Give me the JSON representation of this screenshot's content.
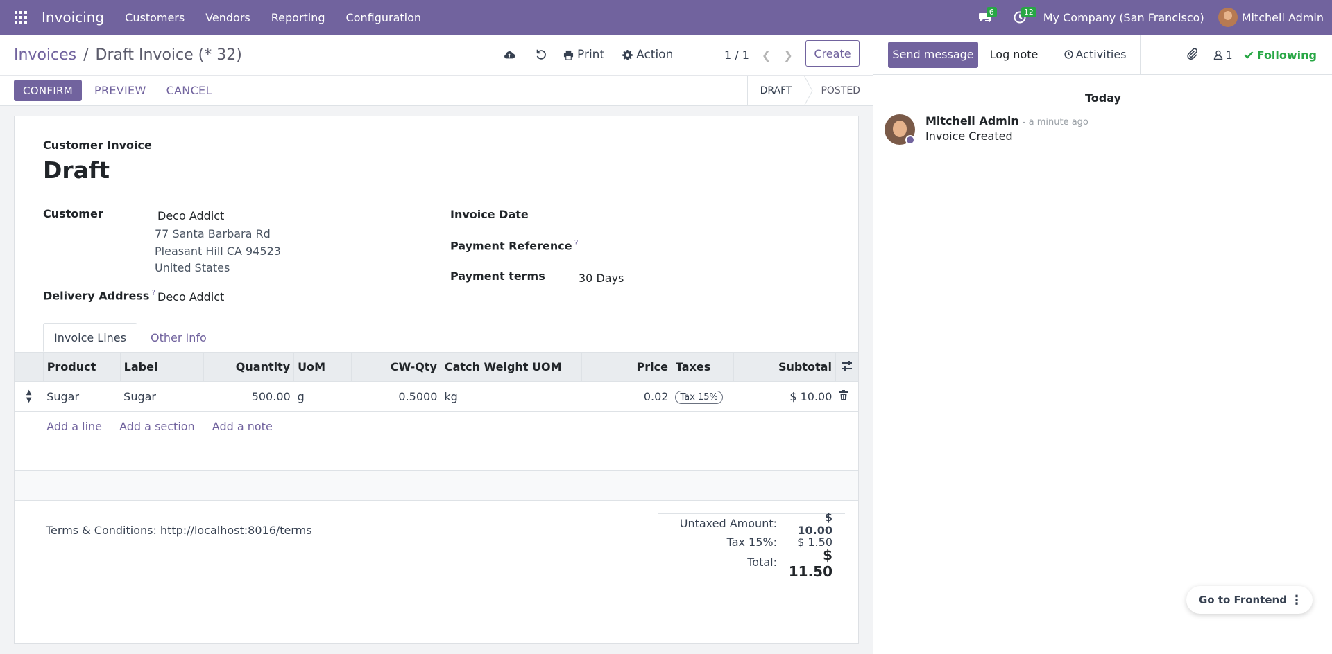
{
  "navbar": {
    "app_name": "Invoicing",
    "menus": [
      "Customers",
      "Vendors",
      "Reporting",
      "Configuration"
    ],
    "messages_count": "6",
    "activities_count": "12",
    "company": "My Company (San Francisco)",
    "user": "Mitchell Admin"
  },
  "breadcrumb": {
    "parent": "Invoices",
    "separator": "/",
    "current": "Draft Invoice (* 32)"
  },
  "toolbar": {
    "print_label": "Print",
    "action_label": "Action",
    "pager": "1 / 1",
    "create_label": "Create"
  },
  "buttons": {
    "confirm": "CONFIRM",
    "preview": "PREVIEW",
    "cancel": "CANCEL"
  },
  "status": {
    "draft": "DRAFT",
    "posted": "POSTED",
    "active": "DRAFT"
  },
  "form": {
    "doc_type": "Customer Invoice",
    "title": "Draft",
    "customer_label": "Customer",
    "customer_name": "Deco Addict",
    "address_line1": "77 Santa Barbara Rd",
    "address_line2": "Pleasant Hill CA 94523",
    "address_line3": "United States",
    "delivery_label": "Delivery Address",
    "delivery_value": "Deco Addict",
    "invoice_date_label": "Invoice Date",
    "payment_ref_label": "Payment Reference",
    "payment_terms_label": "Payment terms",
    "payment_terms_value": "30 Days",
    "help_mark": "?"
  },
  "tabs": {
    "lines": "Invoice Lines",
    "other": "Other Info"
  },
  "table": {
    "headers": {
      "product": "Product",
      "label": "Label",
      "quantity": "Quantity",
      "uom": "UoM",
      "cwqty": "CW-Qty",
      "cwuom": "Catch Weight UOM",
      "price": "Price",
      "taxes": "Taxes",
      "subtotal": "Subtotal"
    },
    "row": {
      "product": "Sugar",
      "label": "Sugar",
      "quantity": "500.00",
      "uom": "g",
      "cwqty": "0.5000",
      "cwuom": "kg",
      "price": "0.02",
      "tax": "Tax 15%",
      "subtotal": "$ 10.00"
    },
    "add_line": "Add a line",
    "add_section": "Add a section",
    "add_note": "Add a note"
  },
  "terms": "Terms & Conditions: http://localhost:8016/terms",
  "totals": {
    "untaxed_label": "Untaxed Amount:",
    "untaxed_value": "$ 10.00",
    "tax_label": "Tax 15%:",
    "tax_value": "$ 1.50",
    "total_label": "Total:",
    "total_value": "$ 11.50"
  },
  "chatter": {
    "send_message": "Send message",
    "log_note": "Log note",
    "activities": "Activities",
    "followers_count": "1",
    "following": "Following",
    "day_separator": "Today",
    "message": {
      "author": "Mitchell Admin",
      "time": "- a minute ago",
      "body": "Invoice Created"
    }
  },
  "floating": {
    "go_frontend": "Go to Frontend"
  },
  "colors": {
    "primary": "#71639e",
    "success": "#28a745"
  },
  "icons": [
    "apps-grid-icon",
    "chat-icon",
    "clock-icon",
    "cloud-upload-icon",
    "undo-icon",
    "print-icon",
    "gear-icon",
    "chevron-left-icon",
    "chevron-right-icon",
    "drag-handle-icon",
    "trash-icon",
    "column-settings-icon",
    "paperclip-icon",
    "user-icon",
    "check-icon",
    "more-vertical-icon"
  ]
}
